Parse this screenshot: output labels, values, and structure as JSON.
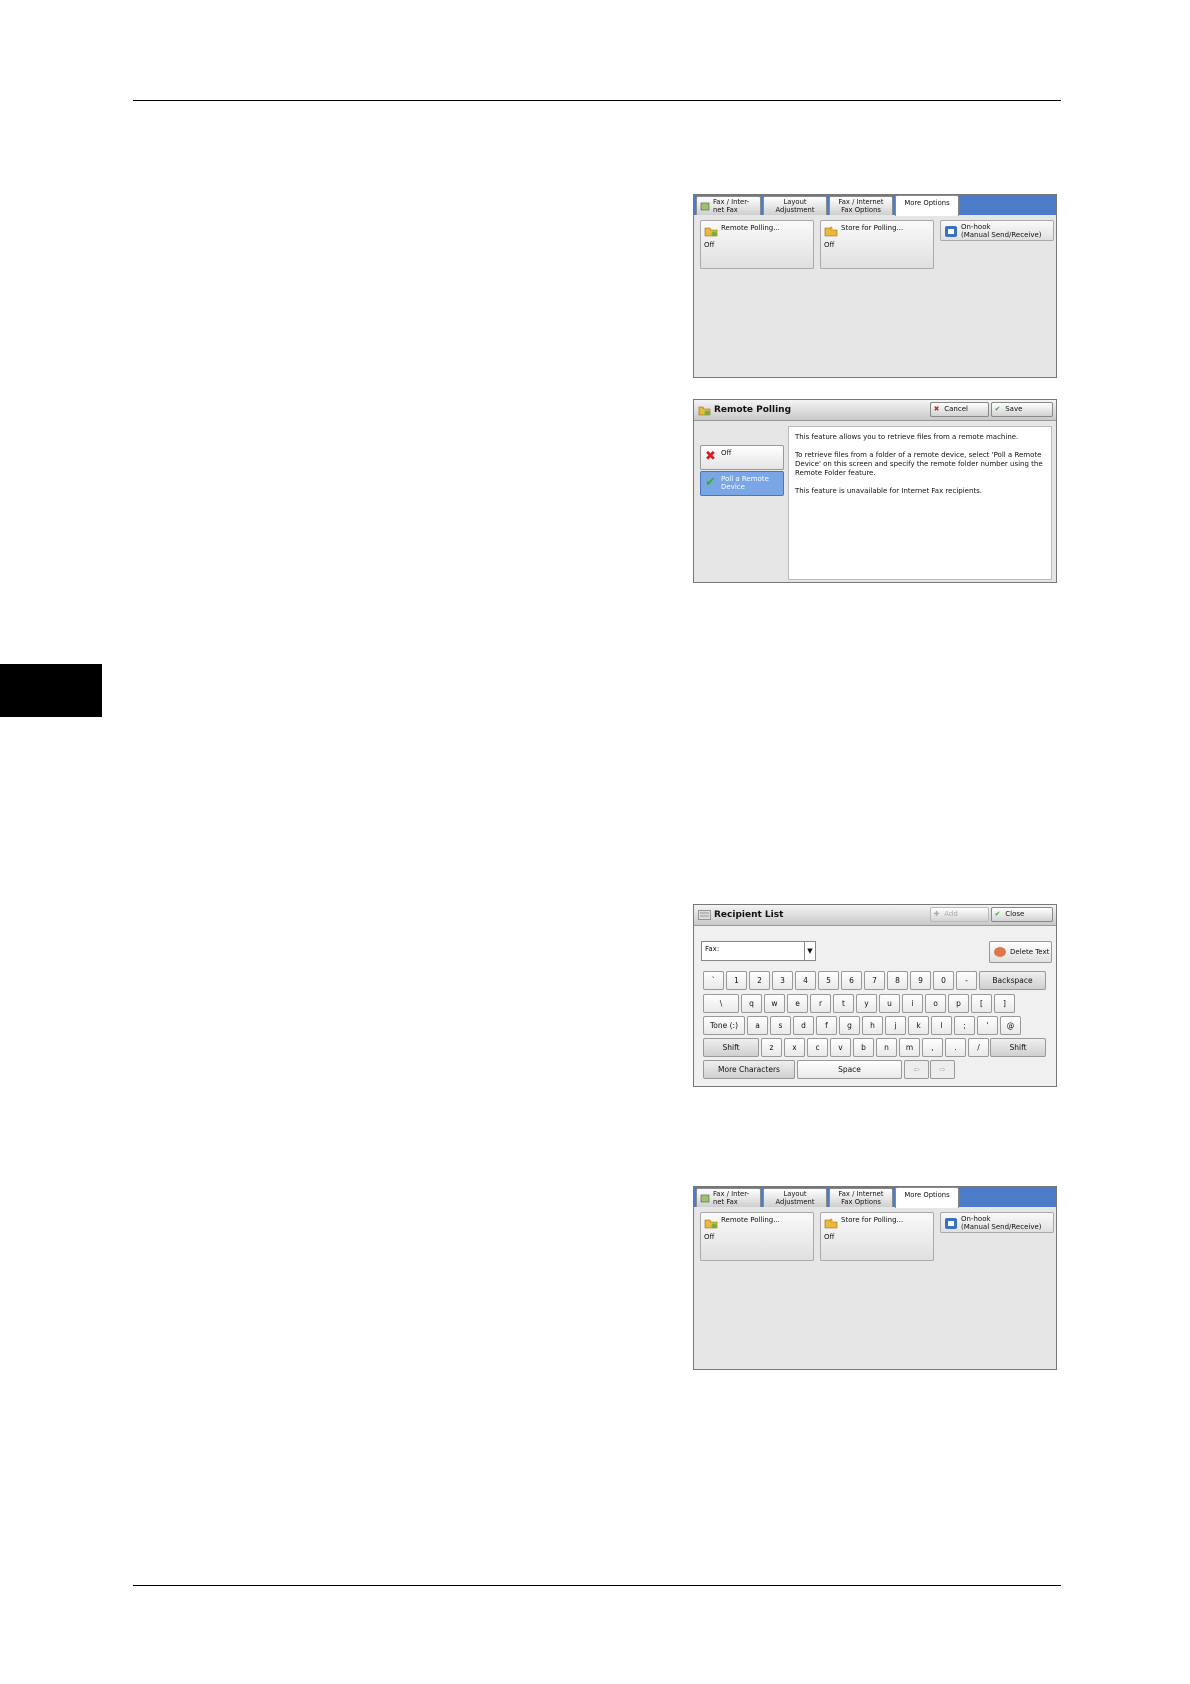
{
  "fax_tabs": {
    "tab1": "Fax / Inter-\nnet Fax",
    "tab2": "Layout\nAdjustment",
    "tab3": "Fax / Internet\nFax Options",
    "tab4": "More Options"
  },
  "fax_buttons": {
    "remote_polling": "Remote Polling...",
    "remote_polling_value": "Off",
    "store_for_polling": "Store for Polling...",
    "store_for_polling_value": "Off",
    "on_hook": "On-hook\n(Manual Send/Receive)"
  },
  "remote_polling": {
    "title": "Remote Polling",
    "cancel": "Cancel",
    "save": "Save",
    "option_off": "Off",
    "option_poll": "Poll a Remote\nDevice",
    "desc1": "This feature allows you to retrieve files from a remote machine.",
    "desc2": "To retrieve files from a folder of a remote device, select 'Poll a Remote Device' on this screen and specify the remote folder number using the Remote Folder feature.",
    "desc3": "This feature is unavailable for Internet Fax recipients."
  },
  "recipient_list": {
    "title": "Recipient List",
    "add": "Add",
    "close": "Close",
    "combo_value": "Fax:",
    "delete_text": "Delete Text",
    "backspace": "Backspace",
    "tone": "Tone (:)",
    "shift": "Shift",
    "more_chars": "More Characters",
    "space": "Space",
    "row1": [
      "`",
      "1",
      "2",
      "3",
      "4",
      "5",
      "6",
      "7",
      "8",
      "9",
      "0",
      "-"
    ],
    "row2": [
      "\\",
      "q",
      "w",
      "e",
      "r",
      "t",
      "y",
      "u",
      "i",
      "o",
      "p",
      "[",
      "]"
    ],
    "row3": [
      "a",
      "s",
      "d",
      "f",
      "g",
      "h",
      "j",
      "k",
      "l",
      ";",
      "'",
      "@"
    ],
    "row4": [
      "z",
      "x",
      "c",
      "v",
      "b",
      "n",
      "m",
      ",",
      ".",
      "/"
    ]
  },
  "colors": {
    "tab_blue": "#4d7cc9",
    "selected_blue": "#7aa6e6",
    "cancel_red": "#d62020",
    "save_green": "#3aa93a"
  }
}
